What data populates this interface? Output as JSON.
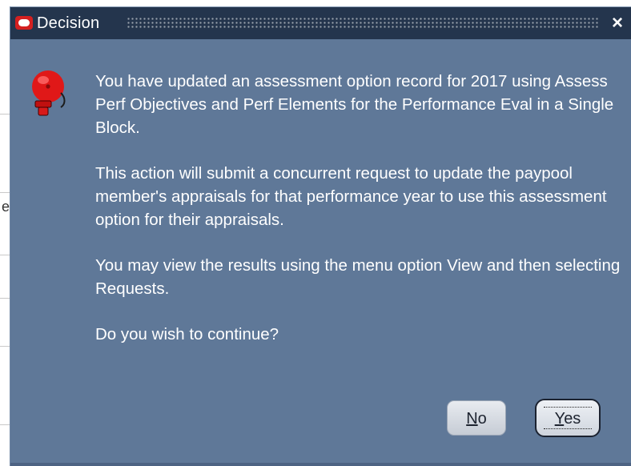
{
  "window": {
    "title": "Decision",
    "close_glyph": "×"
  },
  "background": {
    "fragment_char": "e"
  },
  "dialog": {
    "icon": "alarm-bell-icon",
    "message_paragraphs": [
      "You have updated an assessment option record for 2017 using Assess Perf Objectives and Perf Elements for the Performance Eval in a Single Block.",
      "This action will submit a concurrent request to update the paypool member's appraisals for that performance year to use this assessment option for their appraisals.",
      "You may view the results using the menu option View and then selecting Requests.",
      "Do you wish to continue?"
    ],
    "buttons": {
      "no": {
        "mnemonic": "N",
        "rest": "o"
      },
      "yes": {
        "mnemonic": "Y",
        "rest": "es"
      }
    }
  },
  "colors": {
    "dialog_bg": "#5f7898",
    "titlebar_bg": "#24354d",
    "logo_red": "#d42020",
    "bell_red": "#e01818"
  }
}
